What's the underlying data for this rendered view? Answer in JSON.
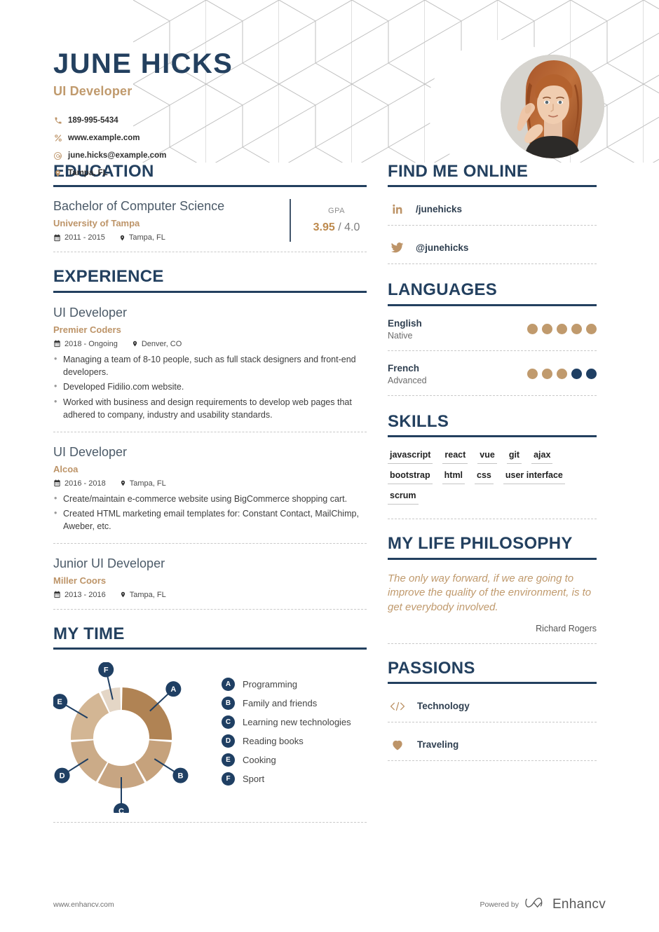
{
  "header": {
    "name": "JUNE HICKS",
    "role": "UI Developer",
    "contacts": [
      {
        "icon": "phone-icon",
        "text": "189-995-5434"
      },
      {
        "icon": "link-icon",
        "text": "www.example.com"
      },
      {
        "icon": "email-icon",
        "text": "june.hicks@example.com"
      },
      {
        "icon": "location-icon",
        "text": "Tampa, FL"
      }
    ],
    "photo_alt": "profile-photo"
  },
  "education": {
    "title": "EDUCATION",
    "entries": [
      {
        "degree": "Bachelor of Computer Science",
        "school": "University of Tampa",
        "dates": "2011 - 2015",
        "location": "Tampa, FL",
        "gpa_label": "GPA",
        "gpa_value": "3.95",
        "gpa_sep": "/",
        "gpa_max": "4.0"
      }
    ]
  },
  "experience": {
    "title": "EXPERIENCE",
    "jobs": [
      {
        "title": "UI Developer",
        "company": "Premier Coders",
        "dates": "2018 - Ongoing",
        "location": "Denver, CO",
        "bullets": [
          "Managing a team of 8-10 people, such as full stack designers and front-end developers.",
          "Developed Fidilio.com website.",
          "Worked with business and design requirements to develop web pages that adhered to company, industry and usability standards."
        ]
      },
      {
        "title": "UI Developer",
        "company": "Alcoa",
        "dates": "2016 - 2018",
        "location": "Tampa, FL",
        "bullets": [
          "Create/maintain e-commerce website using BigCommerce shopping cart.",
          "Created HTML marketing email templates for: Constant Contact, MailChimp, Aweber, etc."
        ]
      },
      {
        "title": "Junior UI Developer",
        "company": "Miller Coors",
        "dates": "2013 - 2016",
        "location": "Tampa, FL",
        "bullets": []
      }
    ]
  },
  "mytime": {
    "title": "MY TIME",
    "legend": [
      {
        "key": "A",
        "label": "Programming"
      },
      {
        "key": "B",
        "label": "Family and friends"
      },
      {
        "key": "C",
        "label": "Learning new technologies"
      },
      {
        "key": "D",
        "label": "Reading books"
      },
      {
        "key": "E",
        "label": "Cooking"
      },
      {
        "key": "F",
        "label": "Sport"
      }
    ]
  },
  "chart_data": {
    "type": "pie",
    "title": "MY TIME",
    "subtype": "donut",
    "categories": [
      "Programming",
      "Family and friends",
      "Learning new technologies",
      "Reading books",
      "Cooking",
      "Sport"
    ],
    "keys": [
      "A",
      "B",
      "C",
      "D",
      "E",
      "F"
    ],
    "values": [
      26,
      16,
      16,
      16,
      19,
      7
    ],
    "unit": "percent",
    "colors": [
      "#b08354",
      "#c6a27c",
      "#c7a582",
      "#cbab88",
      "#d3b694",
      "#e4d6c6"
    ],
    "legend_position": "right",
    "label_style": "lettered-badges-with-leader-lines"
  },
  "find_me_online": {
    "title": "FIND ME ONLINE",
    "items": [
      {
        "icon": "linkedin-icon",
        "text": "/junehicks"
      },
      {
        "icon": "twitter-icon",
        "text": "@junehicks"
      }
    ]
  },
  "languages": {
    "title": "LANGUAGES",
    "items": [
      {
        "name": "English",
        "level": "Native",
        "filled": 5,
        "total": 5
      },
      {
        "name": "French",
        "level": "Advanced",
        "filled": 3,
        "total": 5
      }
    ]
  },
  "skills": {
    "title": "SKILLS",
    "items": [
      "javascript",
      "react",
      "vue",
      "git",
      "ajax",
      "bootstrap",
      "html",
      "css",
      "user interface",
      "scrum"
    ]
  },
  "philosophy": {
    "title": "MY LIFE PHILOSOPHY",
    "quote": "The only way forward, if we are going to improve the quality of the environment, is to get everybody involved.",
    "author": "Richard Rogers"
  },
  "passions": {
    "title": "PASSIONS",
    "items": [
      {
        "icon": "code-icon",
        "text": "Technology"
      },
      {
        "icon": "heart-icon",
        "text": "Traveling"
      }
    ]
  },
  "footer": {
    "website": "www.enhancv.com",
    "powered_by": "Powered by",
    "brand": "Enhancv",
    "brand_icon": "enhancv-logo-icon"
  },
  "colors": {
    "navy": "#23405f",
    "tan": "#c09a6d",
    "tan_dark": "#b08354",
    "text": "#3b3b3b"
  }
}
